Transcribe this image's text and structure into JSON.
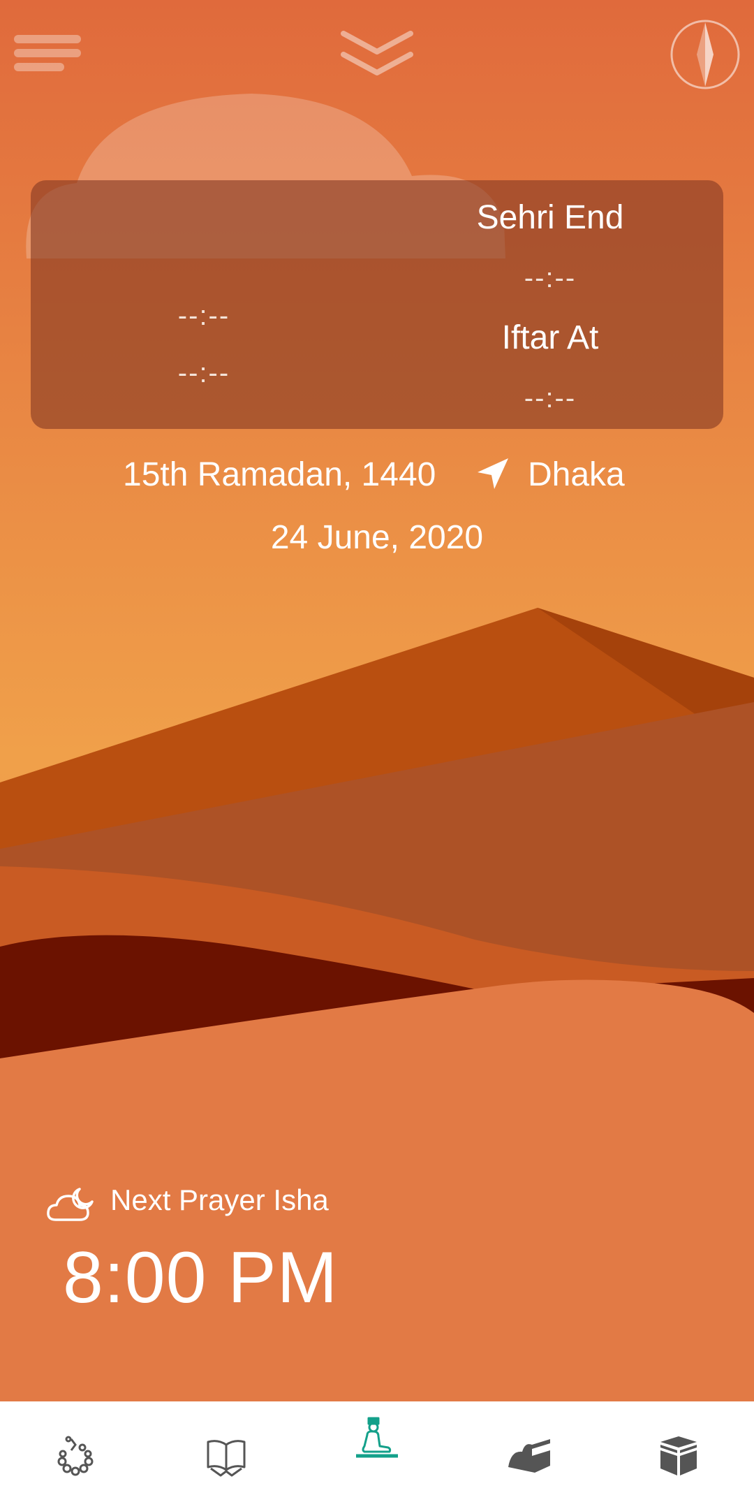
{
  "topbar": {
    "menu_icon": "menu-icon",
    "expand_icon": "chevron-double-down-icon",
    "qibla_icon": "compass-icon"
  },
  "times_card": {
    "left_times": [
      "--:--",
      "--:--"
    ],
    "sehri_label": "Sehri End",
    "sehri_time": "--:--",
    "iftar_label": "Iftar At",
    "iftar_time": "--:--"
  },
  "info": {
    "hijri_date": "15th Ramadan, 1440",
    "location_icon": "location-arrow-icon",
    "city": "Dhaka",
    "gregorian_date": "24 June, 2020"
  },
  "next_prayer": {
    "icon": "cloud-moon-icon",
    "label": "Next Prayer Isha",
    "time": "8:00 PM"
  },
  "bottom_nav": {
    "items": [
      {
        "icon": "tasbih-icon",
        "color": "#555555"
      },
      {
        "icon": "quran-book-icon",
        "color": "#555555"
      },
      {
        "icon": "praying-man-icon",
        "color": "#13a08a",
        "active": true
      },
      {
        "icon": "mosque-icon",
        "color": "#555555"
      },
      {
        "icon": "kaaba-icon",
        "color": "#555555"
      }
    ]
  },
  "colors": {
    "sky_top": "#e06a3c",
    "sky_bottom": "#f0a04a",
    "card": "#7f3521",
    "accent_active": "#13a08a"
  }
}
